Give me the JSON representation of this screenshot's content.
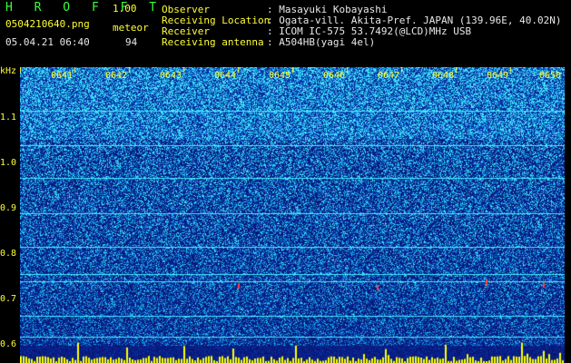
{
  "header": {
    "logo": "H R O F F T",
    "version": "1.00",
    "filename": "0504210640.png",
    "meteor_label": "meteor",
    "meteor_count": "94",
    "timestamp": "05.04.21 06:40",
    "rows": [
      {
        "label": "Observer",
        "value": ": Masayuki Kobayashi"
      },
      {
        "label": "Receiving Location",
        "value": ": Ogata-vill. Akita-Pref. JAPAN (139.96E, 40.02N)"
      },
      {
        "label": "Receiver",
        "value": ": ICOM IC-575 53.7492(@LCD)MHz USB"
      },
      {
        "label": "Receiving antenna",
        "value": ": A504HB(yagi 4el)"
      }
    ]
  },
  "axis": {
    "unit": "kHz",
    "y_ticks": [
      "1.1",
      "1.0",
      "0.9",
      "0.8",
      "0.7",
      "0.6"
    ],
    "time_labels": [
      "0641",
      "0642",
      "0643",
      "0644",
      "0645",
      "0646",
      "0647",
      "0648",
      "0649",
      "0650"
    ]
  },
  "colors": {
    "background": "#000000",
    "text_yellow": "#ffff33",
    "text_white": "#e8e8e8",
    "logo_green": "#3cff3c",
    "spectrogram_low": "#0a1a8c",
    "spectrogram_high": "#38e8ff",
    "meteor_marker": "#ffff00"
  }
}
